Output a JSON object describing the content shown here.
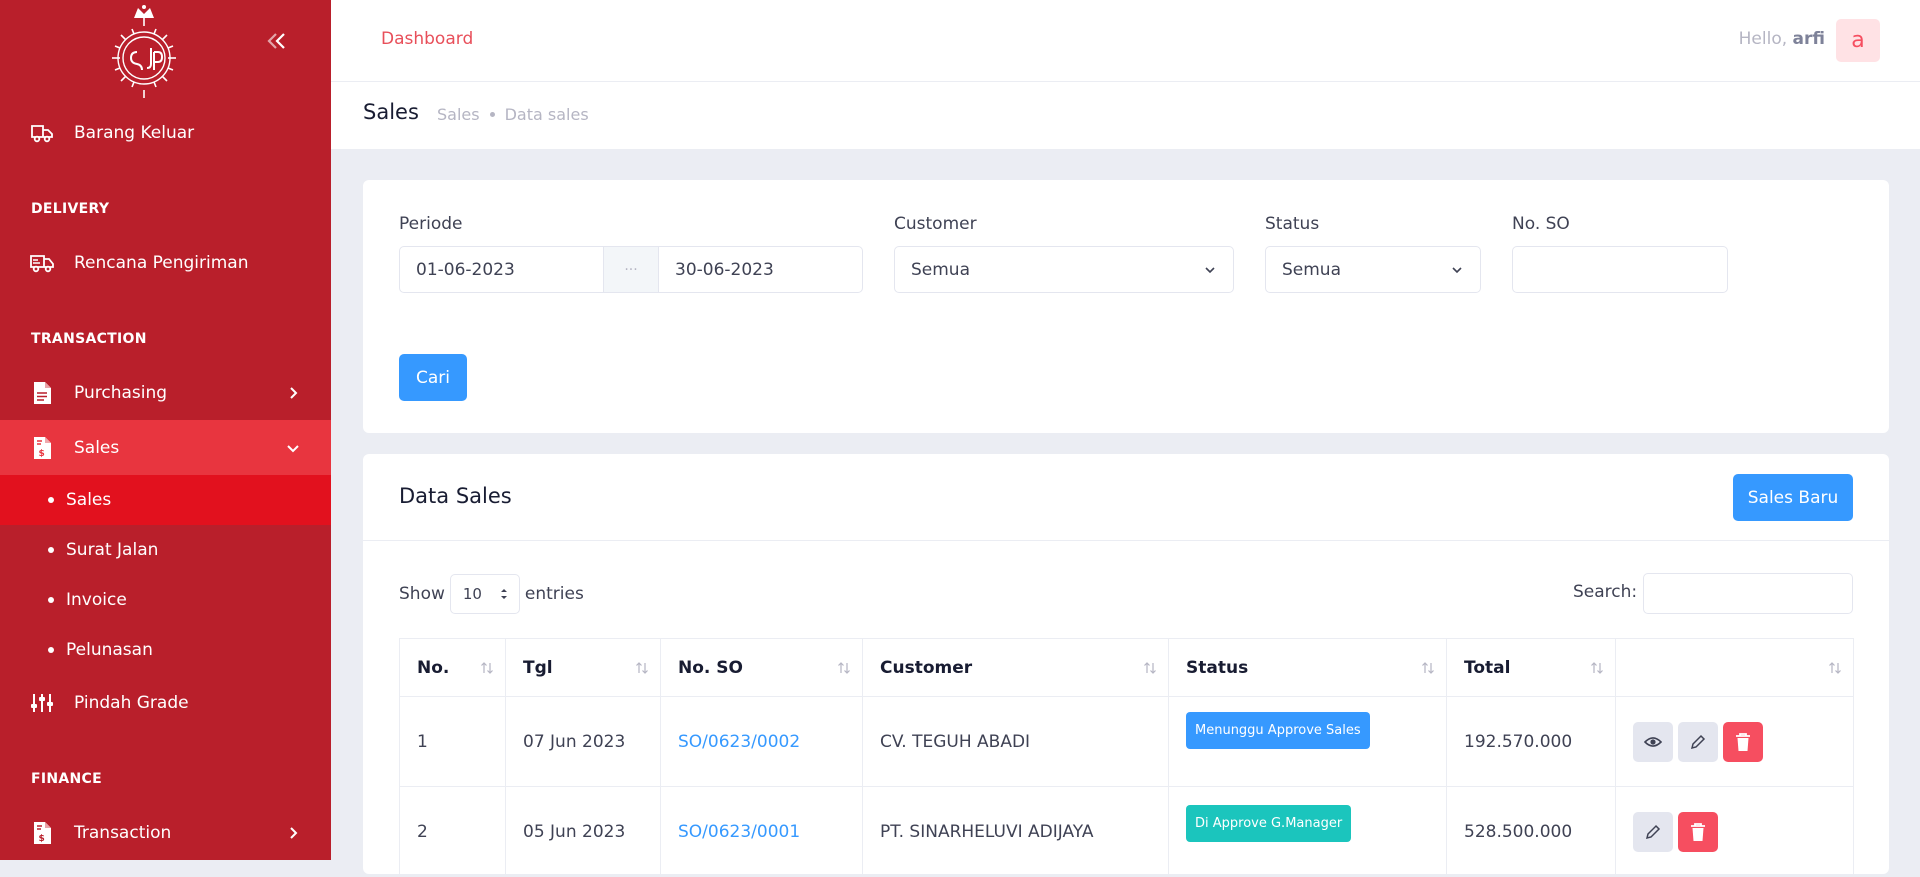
{
  "sidebar": {
    "items": {
      "barang_keluar": "Barang Keluar",
      "delivery_section": "DELIVERY",
      "rencana_pengiriman": "Rencana Pengiriman",
      "transaction_section": "TRANSACTION",
      "purchasing": "Purchasing",
      "sales": "Sales",
      "sub_sales": "Sales",
      "sub_surat_jalan": "Surat Jalan",
      "sub_invoice": "Invoice",
      "sub_pelunasan": "Pelunasan",
      "pindah_grade": "Pindah Grade",
      "finance_section": "FINANCE",
      "transaction": "Transaction"
    },
    "colors": {
      "bg": "#b91f2b",
      "active": "#e8353f",
      "sub_active": "#e2111e"
    }
  },
  "header": {
    "crumb": "Dashboard",
    "hello": "Hello,",
    "user": "arfi",
    "avatar_letter": "a"
  },
  "subheader": {
    "title": "Sales",
    "bc1": "Sales",
    "bc2": "Data sales"
  },
  "filter": {
    "periode_label": "Periode",
    "date_from": "01-06-2023",
    "date_sep": "···",
    "date_to": "30-06-2023",
    "customer_label": "Customer",
    "customer_value": "Semua",
    "status_label": "Status",
    "status_value": "Semua",
    "so_label": "No. SO",
    "cari": "Cari"
  },
  "data": {
    "title": "Data Sales",
    "new_button": "Sales Baru",
    "show": "Show",
    "entries_value": "10",
    "entries": "entries",
    "search_label": "Search:",
    "columns": [
      "No.",
      "Tgl",
      "No. SO",
      "Customer",
      "Status",
      "Total",
      ""
    ],
    "rows": [
      {
        "no": "1",
        "tgl": "07 Jun 2023",
        "so": "SO/0623/0002",
        "customer": "CV. TEGUH ABADI",
        "status": "Menunggu Approve Sales",
        "status_color": "#3699ff",
        "total": "192.570.000"
      },
      {
        "no": "2",
        "tgl": "05 Jun 2023",
        "so": "SO/0623/0001",
        "customer": "PT. SINARHELUVI ADIJAYA",
        "status": "Di Approve G.Manager",
        "status_color": "#1bc5bd",
        "total": "528.500.000"
      }
    ]
  }
}
